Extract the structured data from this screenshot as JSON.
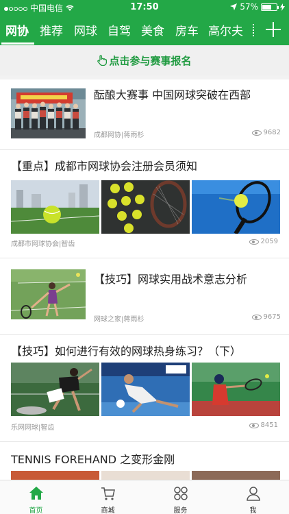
{
  "status_bar": {
    "carrier": "中国电信",
    "time": "17:50",
    "battery": "57%"
  },
  "tabs": [
    {
      "label": "网协",
      "active": true
    },
    {
      "label": "推荐"
    },
    {
      "label": "网球"
    },
    {
      "label": "自驾"
    },
    {
      "label": "美食"
    },
    {
      "label": "房车"
    },
    {
      "label": "高尔夫"
    }
  ],
  "signup": {
    "label": "点击参与赛事报名",
    "icon": "hand-pointer-icon"
  },
  "articles": [
    {
      "title": "酝酿大赛事 中国网球突破在西部",
      "source": "成都网协|蒋雨杉",
      "views": "9682"
    },
    {
      "title": "【重点】成都市网球协会注册会员须知",
      "source": "成都市网球协会|智齿",
      "views": "2059"
    },
    {
      "title": "【技巧】网球实用战术意志分析",
      "source": "网球之家|蒋雨杉",
      "views": "9675"
    },
    {
      "title": "【技巧】如何进行有效的网球热身练习？（下）",
      "source": "乐网网球|智齿",
      "views": "8451"
    },
    {
      "title": "TENNIS FOREHAND 之变形金刚"
    }
  ],
  "bottom_nav": [
    {
      "label": "首页",
      "icon": "home-icon",
      "active": true
    },
    {
      "label": "商城",
      "icon": "cart-icon"
    },
    {
      "label": "服务",
      "icon": "grid-icon"
    },
    {
      "label": "我",
      "icon": "user-icon"
    }
  ],
  "colors": {
    "brand_green": "#23a847",
    "signup_green": "#1e9a3f"
  }
}
